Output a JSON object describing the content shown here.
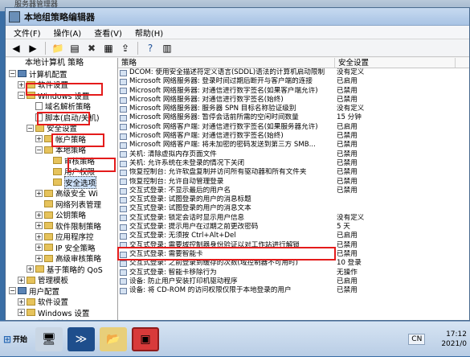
{
  "outer_title": "服务器管理器",
  "window": {
    "title": "本地组策略编辑器"
  },
  "menu": [
    "文件(F)",
    "操作(A)",
    "查看(V)",
    "帮助(H)"
  ],
  "tree": {
    "header": "本地计算机 策略",
    "items": [
      {
        "label": "计算机配置",
        "indent": 0,
        "icon": "pc",
        "expander": "-"
      },
      {
        "label": "软件设置",
        "indent": 1,
        "icon": "folder",
        "expander": "+"
      },
      {
        "label": "Windows 设置",
        "indent": 1,
        "icon": "folder",
        "expander": "-"
      },
      {
        "label": "域名解析策略",
        "indent": 2,
        "icon": "doc",
        "expander": ""
      },
      {
        "label": "脚本(启动/关机)",
        "indent": 2,
        "icon": "doc",
        "expander": ""
      },
      {
        "label": "安全设置",
        "indent": 2,
        "icon": "folder",
        "expander": "-"
      },
      {
        "label": "帐户策略",
        "indent": 3,
        "icon": "folder",
        "expander": "+"
      },
      {
        "label": "本地策略",
        "indent": 3,
        "icon": "folder",
        "expander": "-"
      },
      {
        "label": "审核策略",
        "indent": 4,
        "icon": "folder",
        "expander": ""
      },
      {
        "label": "用户权限",
        "indent": 4,
        "icon": "folder",
        "expander": ""
      },
      {
        "label": "安全选项",
        "indent": 4,
        "icon": "folder",
        "expander": "",
        "selected": true
      },
      {
        "label": "高级安全 Wi",
        "indent": 3,
        "icon": "folder",
        "expander": "+"
      },
      {
        "label": "网络列表管理",
        "indent": 3,
        "icon": "folder",
        "expander": ""
      },
      {
        "label": "公钥策略",
        "indent": 3,
        "icon": "folder",
        "expander": "+"
      },
      {
        "label": "软件限制策略",
        "indent": 3,
        "icon": "folder",
        "expander": "+"
      },
      {
        "label": "应用程序控",
        "indent": 3,
        "icon": "folder",
        "expander": "+"
      },
      {
        "label": "IP 安全策略",
        "indent": 3,
        "icon": "folder",
        "expander": "+"
      },
      {
        "label": "高级审核策略",
        "indent": 3,
        "icon": "folder",
        "expander": "+"
      },
      {
        "label": "基于策略的 QoS",
        "indent": 2,
        "icon": "folder",
        "expander": "+"
      },
      {
        "label": "管理模板",
        "indent": 1,
        "icon": "folder",
        "expander": "+"
      },
      {
        "label": "用户配置",
        "indent": 0,
        "icon": "pc",
        "expander": "-"
      },
      {
        "label": "软件设置",
        "indent": 1,
        "icon": "folder",
        "expander": "+"
      },
      {
        "label": "Windows 设置",
        "indent": 1,
        "icon": "folder",
        "expander": "+"
      },
      {
        "label": "管理模板",
        "indent": 1,
        "icon": "folder",
        "expander": "+"
      }
    ]
  },
  "list": {
    "columns": [
      "策略",
      "安全设置"
    ],
    "rows": [
      [
        "DCOM: 使用安全描述符定义语言(SDDL)语法的计算机启动限制",
        "没有定义"
      ],
      [
        "Microsoft 网络服务器: 登录时间过期后断开与客户端的连接",
        "已启用"
      ],
      [
        "Microsoft 网络服务器: 对通信进行数字签名(如果客户端允许)",
        "已禁用"
      ],
      [
        "Microsoft 网络服务器: 对通信进行数字签名(始终)",
        "已禁用"
      ],
      [
        "Microsoft 网络服务器: 服务器 SPN 目标名称验证级别",
        "没有定义"
      ],
      [
        "Microsoft 网络服务器: 暂停会话前所需的空闲时间数量",
        "15 分钟"
      ],
      [
        "Microsoft 网络客户端: 对通信进行数字签名(如果服务器允许)",
        "已启用"
      ],
      [
        "Microsoft 网络客户端: 对通信进行数字签名(始终)",
        "已禁用"
      ],
      [
        "Microsoft 网络客户端: 将未加密的密码发送到第三方 SMB...",
        "已禁用"
      ],
      [
        "关机: 清除虚拟内存页面文件",
        "已禁用"
      ],
      [
        "关机: 允许系统在未登录的情况下关闭",
        "已禁用"
      ],
      [
        "恢复控制台: 允许软盘复制并访问所有驱动器和所有文件夹",
        "已禁用"
      ],
      [
        "恢复控制台: 允许自动管理登录",
        "已禁用"
      ],
      [
        "交互式登录: 不显示最后的用户名",
        "已禁用"
      ],
      [
        "交互式登录: 试图登录的用户的消息标题",
        ""
      ],
      [
        "交互式登录: 试图登录的用户的消息文本",
        ""
      ],
      [
        "交互式登录: 锁定会话时显示用户信息",
        "没有定义"
      ],
      [
        "交互式登录: 提示用户在过期之前更改密码",
        "5 天"
      ],
      [
        "交互式登录: 无须按 Ctrl+Alt+Del",
        "已启用"
      ],
      [
        "交互式登录: 需要域控制器身份验证以对工作站进行解锁",
        "已禁用"
      ],
      [
        "交互式登录: 需要智能卡",
        "已禁用"
      ],
      [
        "交互式登录: 之前登录到缓存的次数(域控制器不可用时)",
        "10 登录"
      ],
      [
        "交互式登录: 智能卡移除行为",
        "无操作"
      ],
      [
        "设备: 防止用户安装打印机驱动程序",
        "已启用"
      ],
      [
        "设备: 将 CD-ROM 的访问权限仅限于本地登录的用户",
        "已禁用"
      ]
    ]
  },
  "taskbar": {
    "start_label": "开始",
    "lang": "CN",
    "time": "17:12",
    "date": "2021/0"
  }
}
